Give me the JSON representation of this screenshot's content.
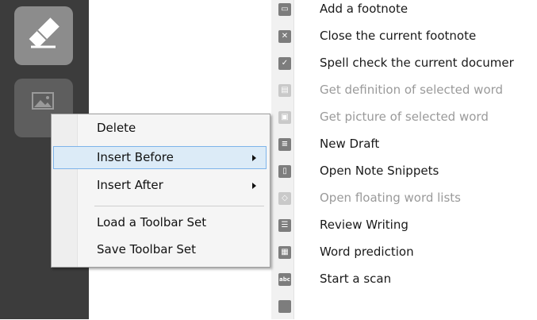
{
  "toolbar": {
    "buttons": [
      {
        "icon": "eraser-icon",
        "enabled": true
      },
      {
        "icon": "picture-icon",
        "enabled": false
      }
    ]
  },
  "submenu": {
    "items": [
      {
        "label": "Add a footnote",
        "icon": "footnote-icon",
        "enabled": true
      },
      {
        "label": "Close the current footnote",
        "icon": "close-icon",
        "enabled": true
      },
      {
        "label": "Spell check the current documer",
        "icon": "spell-check-icon",
        "enabled": true
      },
      {
        "label": "Get definition of selected word",
        "icon": "dictionary-icon",
        "enabled": false
      },
      {
        "label": "Get picture of selected word",
        "icon": "picture-icon",
        "enabled": false
      },
      {
        "label": "New Draft",
        "icon": "new-draft-icon",
        "enabled": true
      },
      {
        "label": "Open Note Snippets",
        "icon": "note-snippets-icon",
        "enabled": true
      },
      {
        "label": "Open floating word lists",
        "icon": "word-list-icon",
        "enabled": false
      },
      {
        "label": "Review Writing",
        "icon": "review-writing-icon",
        "enabled": true
      },
      {
        "label": "Word prediction",
        "icon": "word-prediction-icon",
        "enabled": true
      },
      {
        "label": "Start a scan",
        "icon": "scan-icon",
        "enabled": true
      }
    ]
  },
  "context_menu": {
    "items": [
      {
        "label": "Delete",
        "has_submenu": false,
        "highlighted": false
      },
      {
        "label": "Insert Before",
        "has_submenu": true,
        "highlighted": true
      },
      {
        "label": "Insert After",
        "has_submenu": true,
        "highlighted": false
      },
      {
        "label": "Load a Toolbar Set",
        "has_submenu": false,
        "highlighted": false
      },
      {
        "label": "Save Toolbar Set",
        "has_submenu": false,
        "highlighted": false
      }
    ]
  },
  "colors": {
    "toolbar_bg": "#3c3c3c",
    "toolbar_button": "#8c8c8c",
    "highlight_bg": "#dcebf7",
    "highlight_border": "#7eb4ea"
  }
}
